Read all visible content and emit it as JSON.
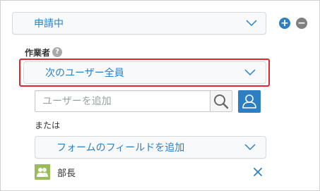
{
  "status_select": {
    "value": "申請中"
  },
  "buttons": {
    "add_symbol": "+",
    "remove_symbol": "−"
  },
  "assignee": {
    "heading": "作業者",
    "help_symbol": "?"
  },
  "assignee_select": {
    "value": "次のユーザー全員"
  },
  "search": {
    "placeholder": "ユーザーを追加"
  },
  "or_label": "または",
  "field_select": {
    "value": "フォームのフィールドを追加"
  },
  "assigned_entries": [
    {
      "name": "部長"
    }
  ],
  "icons": [
    "chevron-down-icon",
    "plus-circle-icon",
    "minus-circle-icon",
    "help-icon",
    "search-icon",
    "user-icon",
    "org-group-icon",
    "remove-x-icon"
  ],
  "colors": {
    "accent": "#2d7fc3",
    "highlight": "#e0272b",
    "group": "#9cbb5c",
    "minus": "#808080"
  }
}
